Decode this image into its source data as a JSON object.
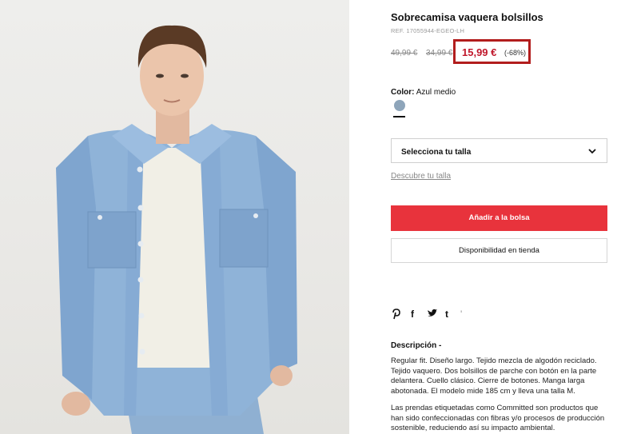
{
  "product": {
    "title": "Sobrecamisa vaquera bolsillos",
    "ref": "REF. 17055944-EGEO-LH",
    "old_price_1": "49,99 €",
    "old_price_2": "34,99 €",
    "price": "15,99 €",
    "discount": "(-68%)",
    "color_label": "Color:",
    "color_value": "Azul medio",
    "swatch_color": "#8ea5ba"
  },
  "size": {
    "label": "Selecciona tu talla",
    "guide": "Descubre tu talla"
  },
  "buttons": {
    "add_to_bag": "Añadir a la bolsa",
    "store_availability": "Disponibilidad en tienda"
  },
  "social": {
    "icons": [
      "pinterest-icon",
      "facebook-icon",
      "twitter-icon",
      "tumblr-icon"
    ],
    "glyphs": [
      "℗",
      "f",
      "🐦",
      "t"
    ],
    "tick": "'"
  },
  "description": {
    "title": "Descripción -",
    "body": "Regular fit. Diseño largo. Tejido mezcla de algodón reciclado. Tejido vaquero. Dos bolsillos de parche con botón en la parte delantera. Cuello clásico. Cierre de botones. Manga larga abotonada. El modelo mide 185 cm y lleva una talla M.",
    "body2": "Las prendas etiquetadas como Committed son productos que han sido confeccionadas con fibras y/o procesos de producción sostenible, reduciendo así su impacto ambiental."
  },
  "colors": {
    "accent_red": "#e8333c",
    "price_red": "#c0172b",
    "highlight_border": "#b21d1d"
  }
}
